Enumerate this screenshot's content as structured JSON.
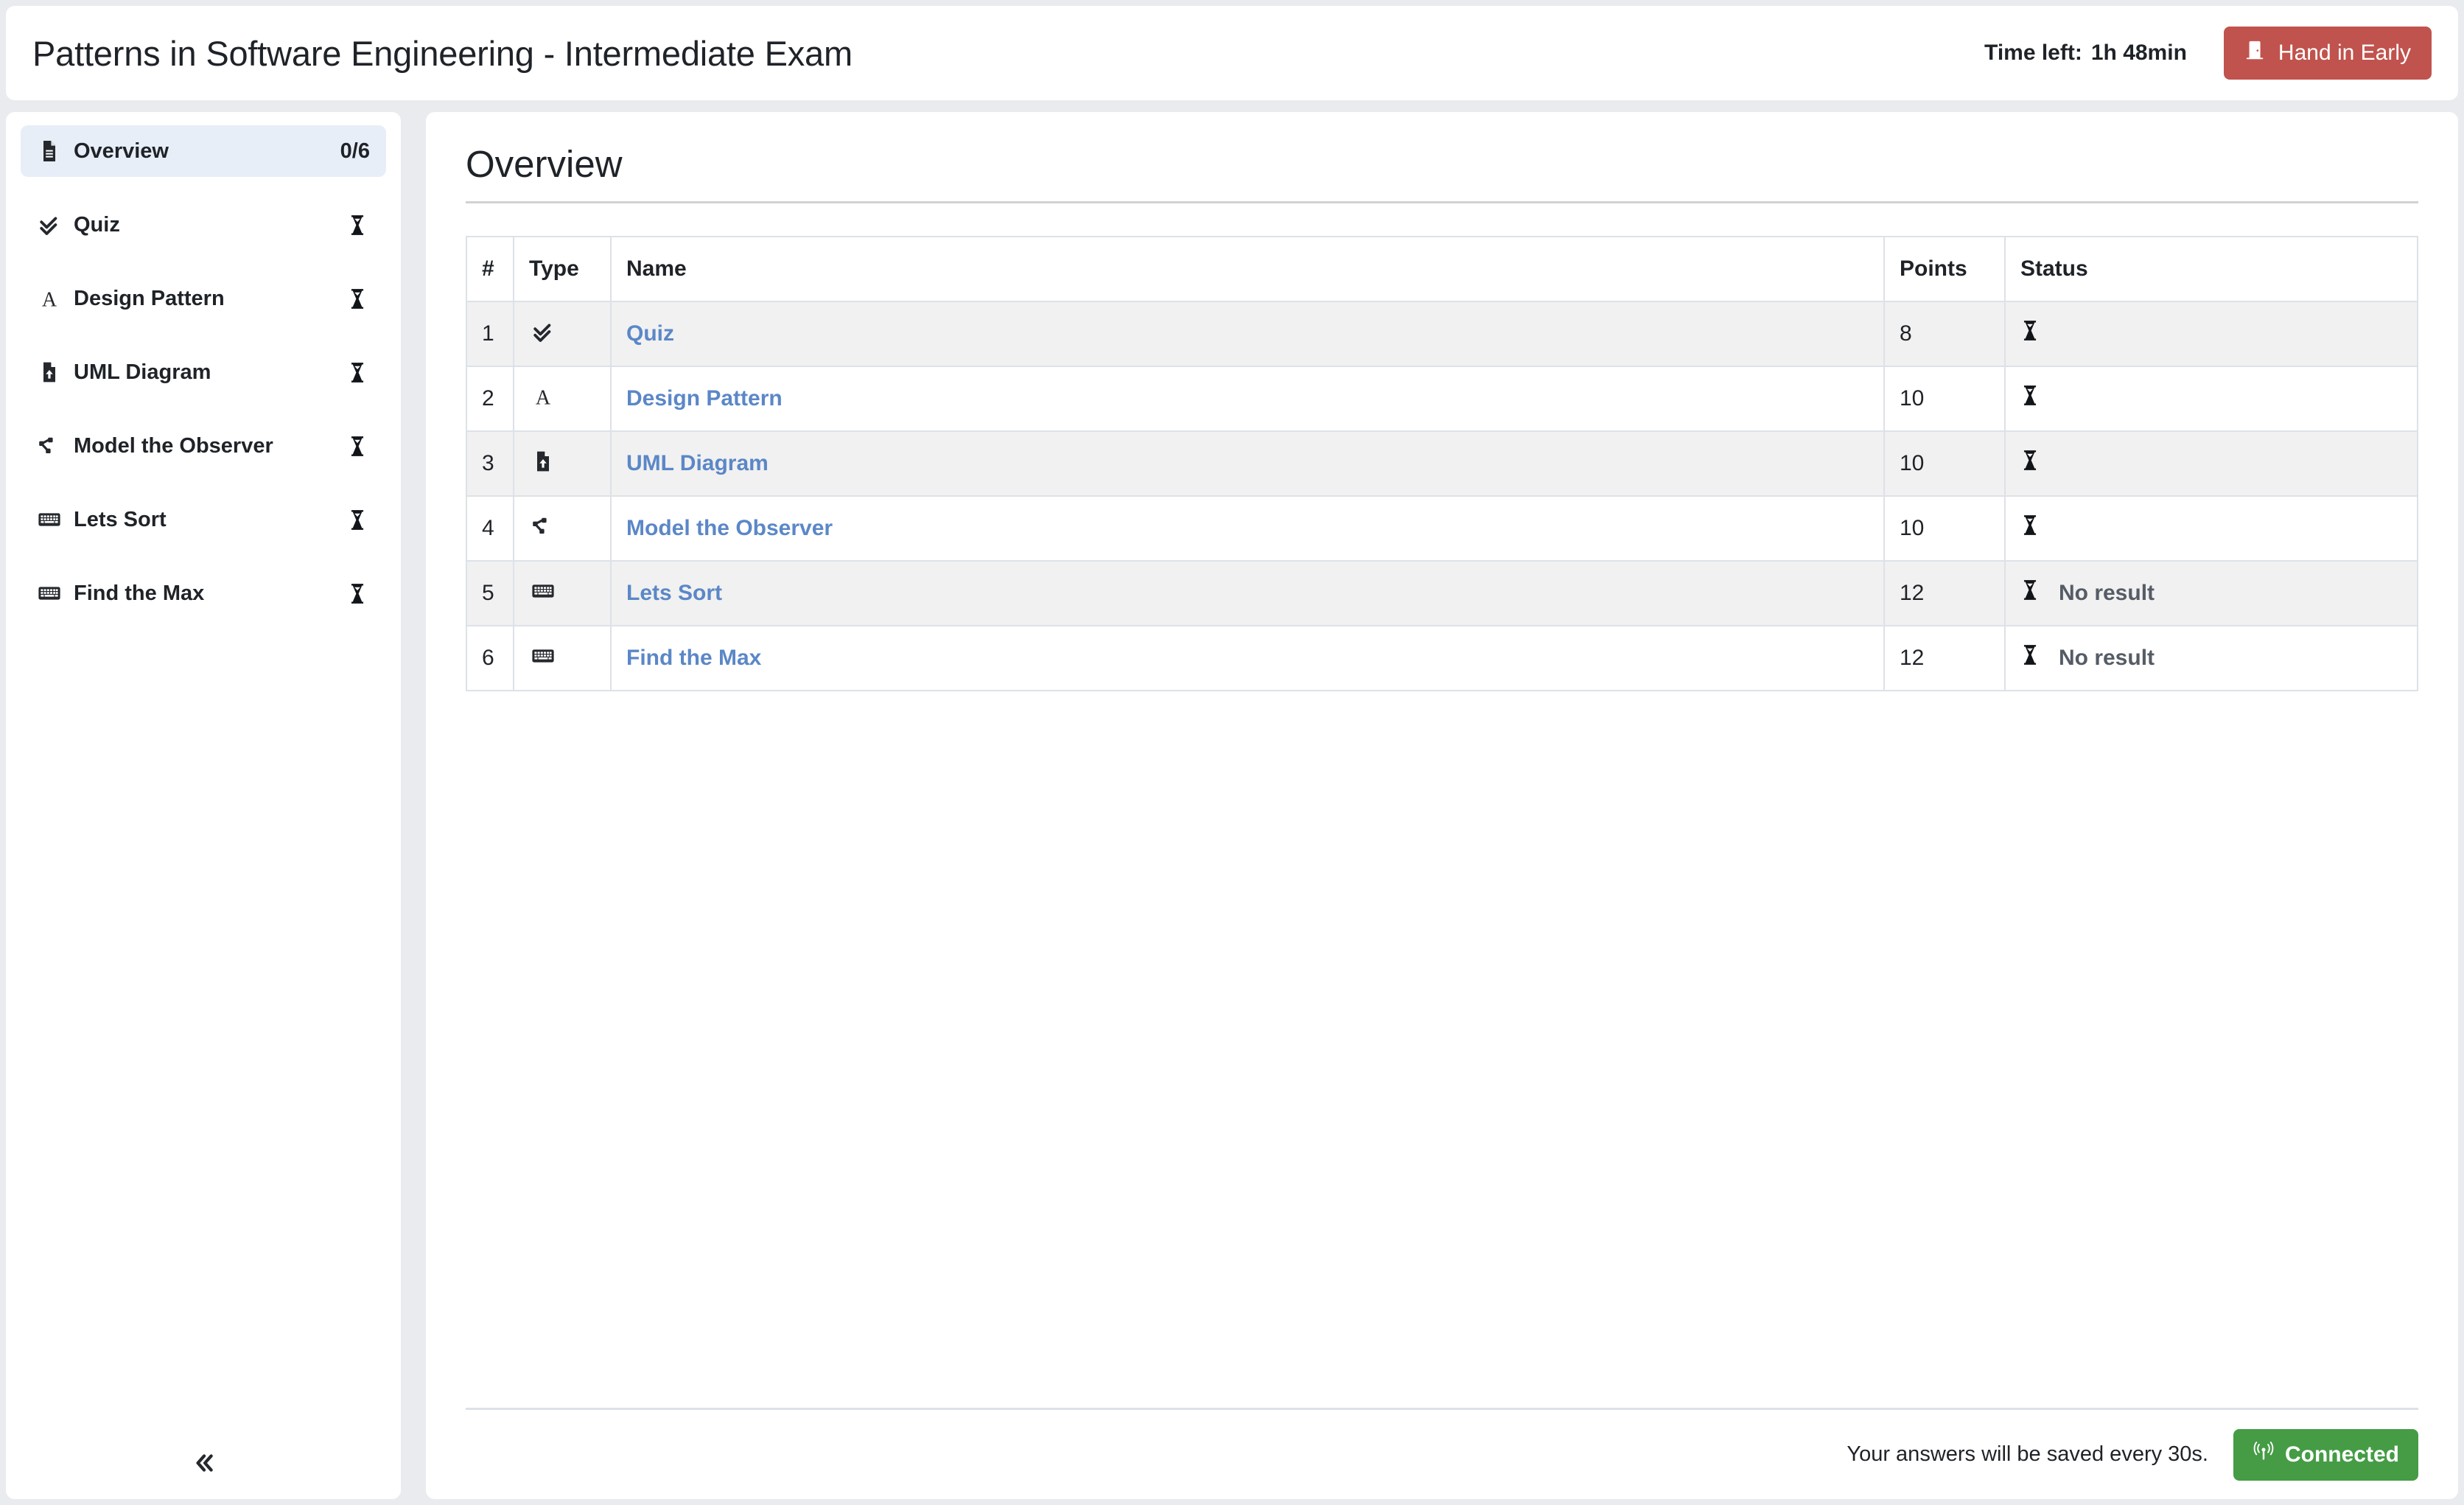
{
  "header": {
    "exam_title": "Patterns in Software Engineering - Intermediate Exam",
    "time_left_label": "Time left:",
    "time_left_value": "1h 48min",
    "hand_in_label": "Hand in Early",
    "hand_in_icon": "door-exit-icon",
    "hand_in_color": "#c0534d"
  },
  "sidebar": {
    "collapse_icon": "chevrons-left-icon",
    "items": [
      {
        "label": "Overview",
        "icon": "file-text-icon",
        "badge": "0/6",
        "status_icon": "",
        "active": true
      },
      {
        "label": "Quiz",
        "icon": "double-check-icon",
        "badge": "",
        "status_icon": "hourglass-icon",
        "active": false
      },
      {
        "label": "Design Pattern",
        "icon": "letter-a-icon",
        "badge": "",
        "status_icon": "hourglass-icon",
        "active": false
      },
      {
        "label": "UML Diagram",
        "icon": "file-upload-icon",
        "badge": "",
        "status_icon": "hourglass-icon",
        "active": false
      },
      {
        "label": "Model the Observer",
        "icon": "graph-node-icon",
        "badge": "",
        "status_icon": "hourglass-icon",
        "active": false
      },
      {
        "label": "Lets Sort",
        "icon": "keyboard-icon",
        "badge": "",
        "status_icon": "hourglass-icon",
        "active": false
      },
      {
        "label": "Find the Max",
        "icon": "keyboard-icon",
        "badge": "",
        "status_icon": "hourglass-icon",
        "active": false
      }
    ]
  },
  "main": {
    "page_title": "Overview",
    "table": {
      "columns": [
        "#",
        "Type",
        "Name",
        "Points",
        "Status"
      ],
      "rows": [
        {
          "num": "1",
          "type_icon": "double-check-icon",
          "name": "Quiz",
          "points": "8",
          "status_icon": "hourglass-icon",
          "status_text": ""
        },
        {
          "num": "2",
          "type_icon": "letter-a-icon",
          "name": "Design Pattern",
          "points": "10",
          "status_icon": "hourglass-icon",
          "status_text": ""
        },
        {
          "num": "3",
          "type_icon": "file-upload-icon",
          "name": "UML Diagram",
          "points": "10",
          "status_icon": "hourglass-icon",
          "status_text": ""
        },
        {
          "num": "4",
          "type_icon": "graph-node-icon",
          "name": "Model the Observer",
          "points": "10",
          "status_icon": "hourglass-icon",
          "status_text": ""
        },
        {
          "num": "5",
          "type_icon": "keyboard-icon",
          "name": "Lets Sort",
          "points": "12",
          "status_icon": "hourglass-icon",
          "status_text": "No result"
        },
        {
          "num": "6",
          "type_icon": "keyboard-icon",
          "name": "Find the Max",
          "points": "12",
          "status_icon": "hourglass-icon",
          "status_text": "No result"
        }
      ]
    },
    "footer": {
      "save_note": "Your answers will be saved every 30s.",
      "connection_label": "Connected",
      "connection_icon": "broadcast-icon",
      "connection_color": "#459c45"
    }
  },
  "colors": {
    "page_background": "#e9ebef",
    "card_background": "#ffffff",
    "link": "#5b87c7",
    "active_nav": "#e8eef7",
    "text": "#1f2328",
    "muted_text": "#555c66",
    "border": "#dde1e8"
  }
}
